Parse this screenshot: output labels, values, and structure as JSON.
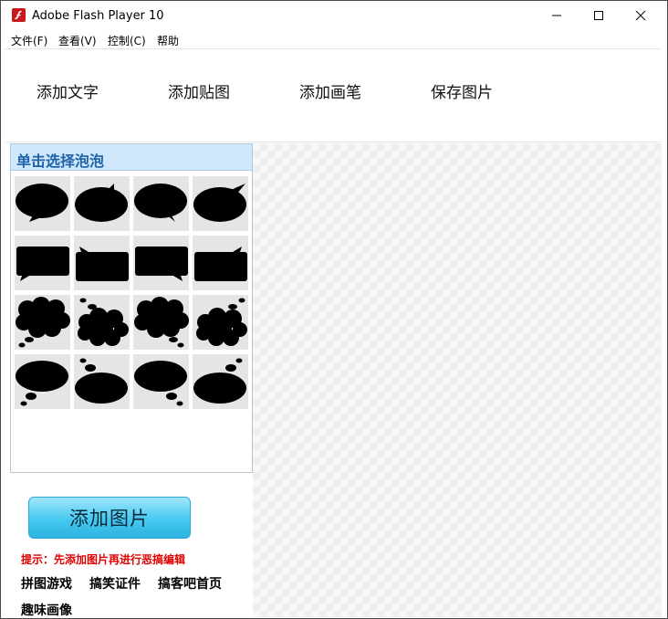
{
  "window": {
    "title": "Adobe Flash Player 10"
  },
  "menu": {
    "items": [
      {
        "label": "文件(F)"
      },
      {
        "label": "查看(V)"
      },
      {
        "label": "控制(C)"
      },
      {
        "label": "帮助"
      }
    ]
  },
  "toolbar": {
    "buttons": [
      {
        "label": "添加文字"
      },
      {
        "label": "添加贴图"
      },
      {
        "label": "添加画笔"
      },
      {
        "label": "保存图片"
      }
    ]
  },
  "bubble_panel": {
    "header": "单击选择泡泡",
    "rows": [
      {
        "style": "speech-round",
        "count": 4
      },
      {
        "style": "speech-rect",
        "count": 4
      },
      {
        "style": "thought-cloud",
        "count": 4
      },
      {
        "style": "thought-oval",
        "count": 4
      }
    ]
  },
  "add_image": {
    "label": "添加图片"
  },
  "tip": "提示：先添加图片再进行恶搞编辑",
  "links": [
    {
      "label": "拼图游戏"
    },
    {
      "label": "搞笑证件"
    },
    {
      "label": "搞客吧首页"
    },
    {
      "label": "趣味画像"
    }
  ],
  "colors": {
    "panel_header_bg": "#cfe7fb",
    "panel_header_text": "#1e62a8",
    "add_button": "#46c9f0",
    "tip_text": "#e00000",
    "app_icon": "#c8171d"
  }
}
